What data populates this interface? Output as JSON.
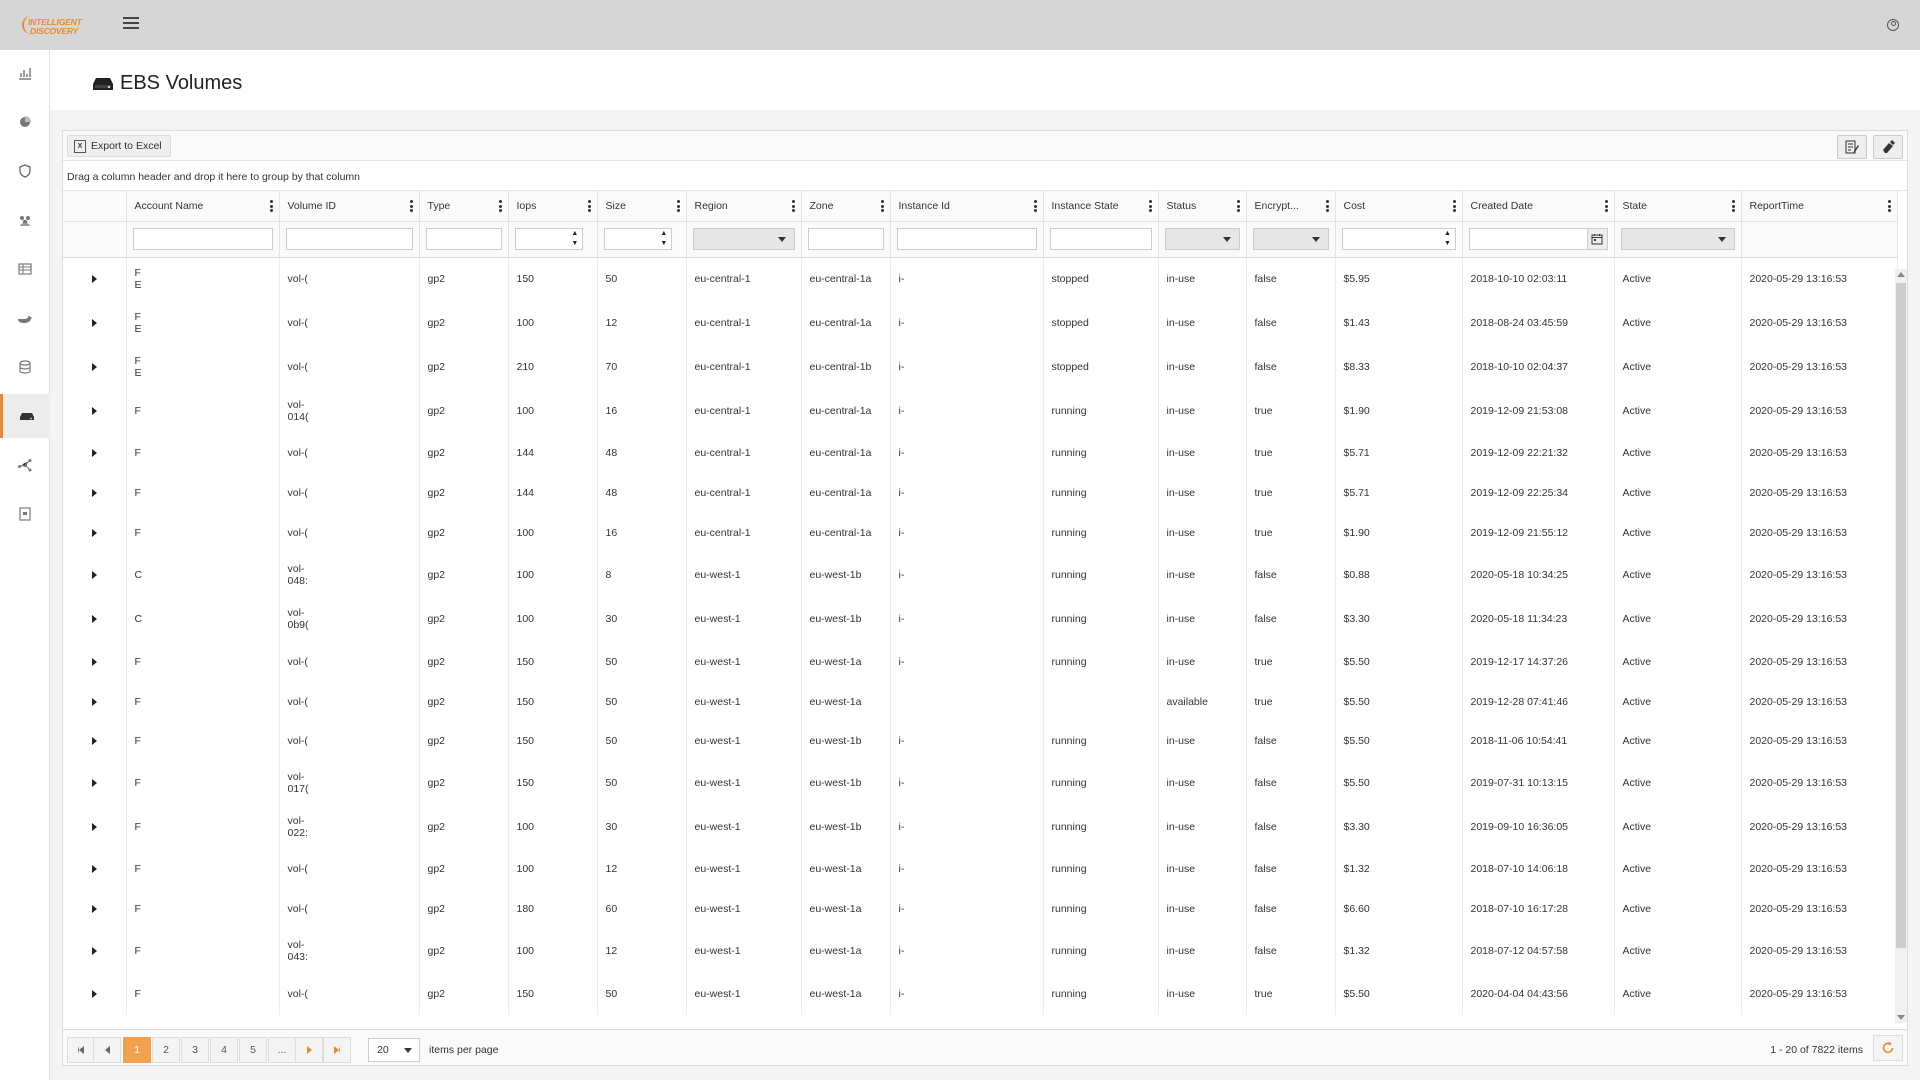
{
  "brand": {
    "line1": "INTELLIGENT",
    "line2": "DISCOVERY",
    "color": "#e98b2c"
  },
  "sidebar": {
    "items": [
      {
        "icon": "bar-chart-icon"
      },
      {
        "icon": "pie-chart-icon"
      },
      {
        "icon": "shield-icon"
      },
      {
        "icon": "users-icon"
      },
      {
        "icon": "table-icon"
      },
      {
        "icon": "docker-icon"
      },
      {
        "icon": "database-icon"
      },
      {
        "icon": "hard-drive-icon",
        "active": true
      },
      {
        "icon": "network-icon"
      },
      {
        "icon": "report-icon"
      }
    ]
  },
  "page": {
    "title": "EBS Volumes"
  },
  "toolbar": {
    "export_label": "Export to Excel"
  },
  "group_hint": "Drag a column header and drop it here to group by that column",
  "columns": [
    "Account Name",
    "Volume ID",
    "Type",
    "Iops",
    "Size",
    "Region",
    "Zone",
    "Instance Id",
    "Instance State",
    "Status",
    "Encrypt...",
    "Cost",
    "Created Date",
    "State",
    "ReportTime"
  ],
  "rows": [
    {
      "acct": "F",
      "acct2": "E",
      "vol": "vol-(",
      "vol2": "",
      "type": "gp2",
      "iops": "150",
      "size": "50",
      "region": "eu-central-1",
      "zone": "eu-central-1a",
      "inst": "i-",
      "istate": "stopped",
      "status": "in-use",
      "enc": "false",
      "cost": "$5.95",
      "created": "2018-10-10 02:03:11",
      "state": "Active",
      "report": "2020-05-29 13:16:53"
    },
    {
      "acct": "F",
      "acct2": "E",
      "vol": "vol-(",
      "vol2": "",
      "type": "gp2",
      "iops": "100",
      "size": "12",
      "region": "eu-central-1",
      "zone": "eu-central-1a",
      "inst": "i-",
      "istate": "stopped",
      "status": "in-use",
      "enc": "false",
      "cost": "$1.43",
      "created": "2018-08-24 03:45:59",
      "state": "Active",
      "report": "2020-05-29 13:16:53"
    },
    {
      "acct": "F",
      "acct2": "E",
      "vol": "vol-(",
      "vol2": "",
      "type": "gp2",
      "iops": "210",
      "size": "70",
      "region": "eu-central-1",
      "zone": "eu-central-1b",
      "inst": "i-",
      "istate": "stopped",
      "status": "in-use",
      "enc": "false",
      "cost": "$8.33",
      "created": "2018-10-10 02:04:37",
      "state": "Active",
      "report": "2020-05-29 13:16:53"
    },
    {
      "acct": "F",
      "acct2": "",
      "vol": "vol-",
      "vol2": "014(",
      "type": "gp2",
      "iops": "100",
      "size": "16",
      "region": "eu-central-1",
      "zone": "eu-central-1a",
      "inst": "i-",
      "istate": "running",
      "status": "in-use",
      "enc": "true",
      "cost": "$1.90",
      "created": "2019-12-09 21:53:08",
      "state": "Active",
      "report": "2020-05-29 13:16:53"
    },
    {
      "acct": "F",
      "acct2": "",
      "vol": "vol-(",
      "vol2": "",
      "type": "gp2",
      "iops": "144",
      "size": "48",
      "region": "eu-central-1",
      "zone": "eu-central-1a",
      "inst": "i-",
      "istate": "running",
      "status": "in-use",
      "enc": "true",
      "cost": "$5.71",
      "created": "2019-12-09 22:21:32",
      "state": "Active",
      "report": "2020-05-29 13:16:53"
    },
    {
      "acct": "F",
      "acct2": "",
      "vol": "vol-(",
      "vol2": "",
      "type": "gp2",
      "iops": "144",
      "size": "48",
      "region": "eu-central-1",
      "zone": "eu-central-1a",
      "inst": "i-",
      "istate": "running",
      "status": "in-use",
      "enc": "true",
      "cost": "$5.71",
      "created": "2019-12-09 22:25:34",
      "state": "Active",
      "report": "2020-05-29 13:16:53"
    },
    {
      "acct": "F",
      "acct2": "",
      "vol": "vol-(",
      "vol2": "",
      "type": "gp2",
      "iops": "100",
      "size": "16",
      "region": "eu-central-1",
      "zone": "eu-central-1a",
      "inst": "i-",
      "istate": "running",
      "status": "in-use",
      "enc": "true",
      "cost": "$1.90",
      "created": "2019-12-09 21:55:12",
      "state": "Active",
      "report": "2020-05-29 13:16:53"
    },
    {
      "acct": "C",
      "acct2": "",
      "vol": "vol-",
      "vol2": "048:",
      "type": "gp2",
      "iops": "100",
      "size": "8",
      "region": "eu-west-1",
      "zone": "eu-west-1b",
      "inst": "i-",
      "istate": "running",
      "status": "in-use",
      "enc": "false",
      "cost": "$0.88",
      "created": "2020-05-18 10:34:25",
      "state": "Active",
      "report": "2020-05-29 13:16:53"
    },
    {
      "acct": "C",
      "acct2": "",
      "vol": "vol-",
      "vol2": "0b9(",
      "type": "gp2",
      "iops": "100",
      "size": "30",
      "region": "eu-west-1",
      "zone": "eu-west-1b",
      "inst": "i-",
      "istate": "running",
      "status": "in-use",
      "enc": "false",
      "cost": "$3.30",
      "created": "2020-05-18 11:34:23",
      "state": "Active",
      "report": "2020-05-29 13:16:53"
    },
    {
      "acct": "F",
      "acct2": "",
      "vol": "vol-(",
      "vol2": "",
      "type": "gp2",
      "iops": "150",
      "size": "50",
      "region": "eu-west-1",
      "zone": "eu-west-1a",
      "inst": "i-",
      "istate": "running",
      "status": "in-use",
      "enc": "true",
      "cost": "$5.50",
      "created": "2019-12-17 14:37:26",
      "state": "Active",
      "report": "2020-05-29 13:16:53"
    },
    {
      "acct": "F",
      "acct2": "",
      "vol": "vol-(",
      "vol2": "",
      "type": "gp2",
      "iops": "150",
      "size": "50",
      "region": "eu-west-1",
      "zone": "eu-west-1a",
      "inst": "",
      "istate": "",
      "status": "available",
      "enc": "true",
      "cost": "$5.50",
      "created": "2019-12-28 07:41:46",
      "state": "Active",
      "report": "2020-05-29 13:16:53"
    },
    {
      "acct": "F",
      "acct2": "",
      "vol": "vol-(",
      "vol2": "",
      "type": "gp2",
      "iops": "150",
      "size": "50",
      "region": "eu-west-1",
      "zone": "eu-west-1b",
      "inst": "i-",
      "istate": "running",
      "status": "in-use",
      "enc": "false",
      "cost": "$5.50",
      "created": "2018-11-06 10:54:41",
      "state": "Active",
      "report": "2020-05-29 13:16:53"
    },
    {
      "acct": "F",
      "acct2": "",
      "vol": "vol-",
      "vol2": "017(",
      "type": "gp2",
      "iops": "150",
      "size": "50",
      "region": "eu-west-1",
      "zone": "eu-west-1b",
      "inst": "i-",
      "istate": "running",
      "status": "in-use",
      "enc": "false",
      "cost": "$5.50",
      "created": "2019-07-31 10:13:15",
      "state": "Active",
      "report": "2020-05-29 13:16:53"
    },
    {
      "acct": "F",
      "acct2": "",
      "vol": "vol-",
      "vol2": "022:",
      "type": "gp2",
      "iops": "100",
      "size": "30",
      "region": "eu-west-1",
      "zone": "eu-west-1b",
      "inst": "i-",
      "istate": "running",
      "status": "in-use",
      "enc": "false",
      "cost": "$3.30",
      "created": "2019-09-10 16:36:05",
      "state": "Active",
      "report": "2020-05-29 13:16:53"
    },
    {
      "acct": "F",
      "acct2": "",
      "vol": "vol-(",
      "vol2": "",
      "type": "gp2",
      "iops": "100",
      "size": "12",
      "region": "eu-west-1",
      "zone": "eu-west-1a",
      "inst": "i-",
      "istate": "running",
      "status": "in-use",
      "enc": "false",
      "cost": "$1.32",
      "created": "2018-07-10 14:06:18",
      "state": "Active",
      "report": "2020-05-29 13:16:53"
    },
    {
      "acct": "F",
      "acct2": "",
      "vol": "vol-(",
      "vol2": "",
      "type": "gp2",
      "iops": "180",
      "size": "60",
      "region": "eu-west-1",
      "zone": "eu-west-1a",
      "inst": "i-",
      "istate": "running",
      "status": "in-use",
      "enc": "false",
      "cost": "$6.60",
      "created": "2018-07-10 16:17:28",
      "state": "Active",
      "report": "2020-05-29 13:16:53"
    },
    {
      "acct": "F",
      "acct2": "",
      "vol": "vol-",
      "vol2": "043:",
      "type": "gp2",
      "iops": "100",
      "size": "12",
      "region": "eu-west-1",
      "zone": "eu-west-1a",
      "inst": "i-",
      "istate": "running",
      "status": "in-use",
      "enc": "false",
      "cost": "$1.32",
      "created": "2018-07-12 04:57:58",
      "state": "Active",
      "report": "2020-05-29 13:16:53"
    },
    {
      "acct": "F",
      "acct2": "",
      "vol": "vol-(",
      "vol2": "",
      "type": "gp2",
      "iops": "150",
      "size": "50",
      "region": "eu-west-1",
      "zone": "eu-west-1a",
      "inst": "i-",
      "istate": "running",
      "status": "in-use",
      "enc": "true",
      "cost": "$5.50",
      "created": "2020-04-04 04:43:56",
      "state": "Active",
      "report": "2020-05-29 13:16:53"
    }
  ],
  "pager": {
    "pages": [
      "1",
      "2",
      "3",
      "4",
      "5",
      "..."
    ],
    "page_size": "20",
    "per_page_label": "items per page",
    "info": "1 - 20 of 7822 items"
  }
}
